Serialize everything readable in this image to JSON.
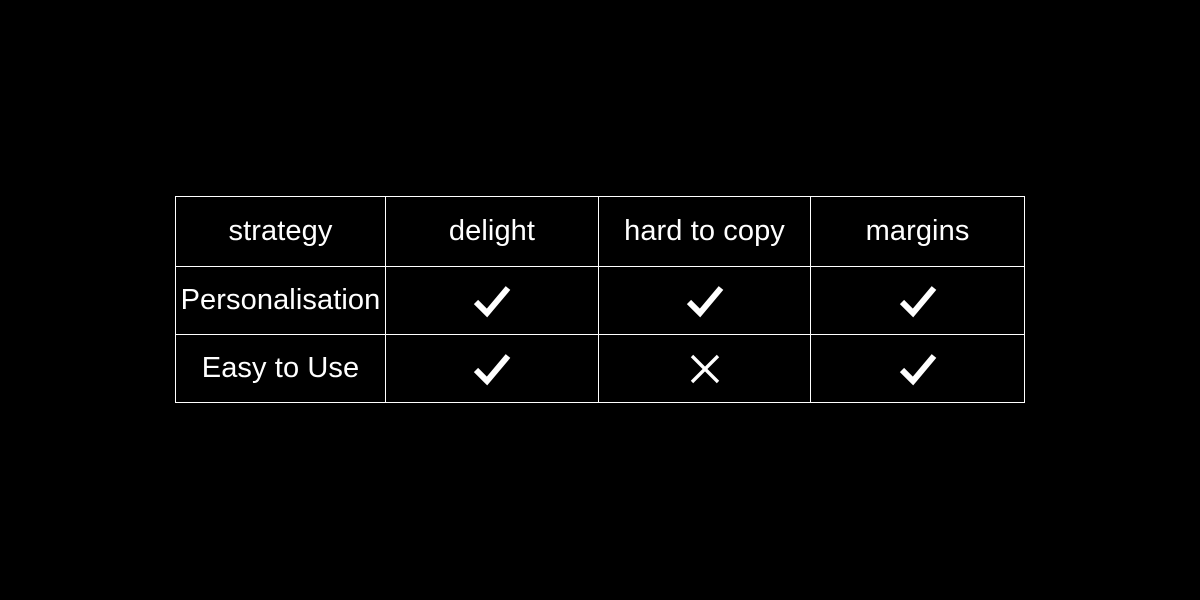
{
  "slide": {
    "background_color": "#000000",
    "text_color": "#ffffff",
    "border_color": "#ffffff"
  },
  "table": {
    "name": "strategy-comparison-table",
    "columns": [
      {
        "key": "strategy",
        "label": "strategy"
      },
      {
        "key": "delight",
        "label": "delight"
      },
      {
        "key": "hard_to_copy",
        "label": "hard to copy"
      },
      {
        "key": "margins",
        "label": "margins"
      }
    ],
    "rows": [
      {
        "label": "Personalisation",
        "cells": [
          {
            "column": "delight",
            "mark": "check-icon",
            "glyph": "✓",
            "value": "yes"
          },
          {
            "column": "hard_to_copy",
            "mark": "check-icon",
            "glyph": "✓",
            "value": "yes"
          },
          {
            "column": "margins",
            "mark": "check-icon",
            "glyph": "✓",
            "value": "yes"
          }
        ]
      },
      {
        "label": "Easy to Use",
        "cells": [
          {
            "column": "delight",
            "mark": "check-icon",
            "glyph": "✓",
            "value": "yes"
          },
          {
            "column": "hard_to_copy",
            "mark": "cross-icon",
            "glyph": "✕",
            "value": "no"
          },
          {
            "column": "margins",
            "mark": "check-icon",
            "glyph": "✓",
            "value": "yes"
          }
        ]
      }
    ]
  }
}
